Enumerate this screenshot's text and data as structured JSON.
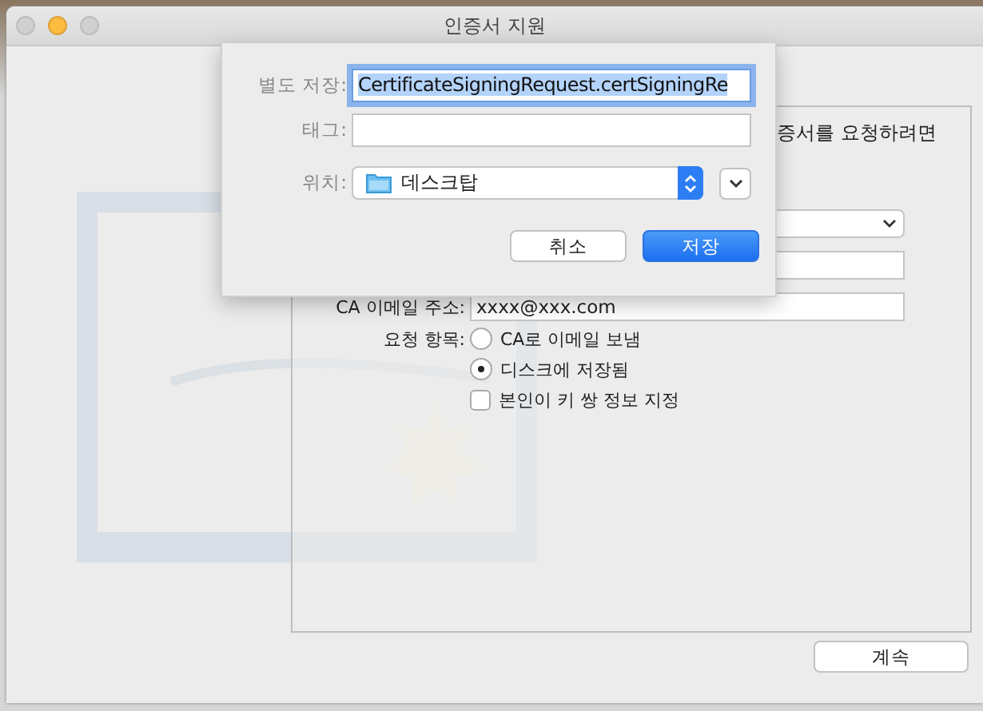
{
  "window": {
    "title": "인증서 지원"
  },
  "request_panel": {
    "intro_text": "증서를 요청하려면",
    "email_label": "CA 이메일 주소:",
    "email_value": "xxxx@xxx.com",
    "request_label": "요청 항목:",
    "options": [
      {
        "kind": "radio",
        "label": "CA로 이메일 보냄",
        "selected": false
      },
      {
        "kind": "radio",
        "label": "디스크에 저장됨",
        "selected": true
      },
      {
        "kind": "checkbox",
        "label": "본인이 키 쌍 정보 지정",
        "checked": false
      }
    ]
  },
  "continue_button": "계속",
  "save_sheet": {
    "save_as_label": "별도 저장:",
    "save_as_value": "CertificateSigningRequest.certSigningRe",
    "tags_label": "태그:",
    "location_label": "위치:",
    "location_value": "데스크탑",
    "buttons": [
      {
        "kind": "cancel",
        "label": "취소"
      },
      {
        "kind": "default",
        "label": "저장"
      }
    ]
  }
}
